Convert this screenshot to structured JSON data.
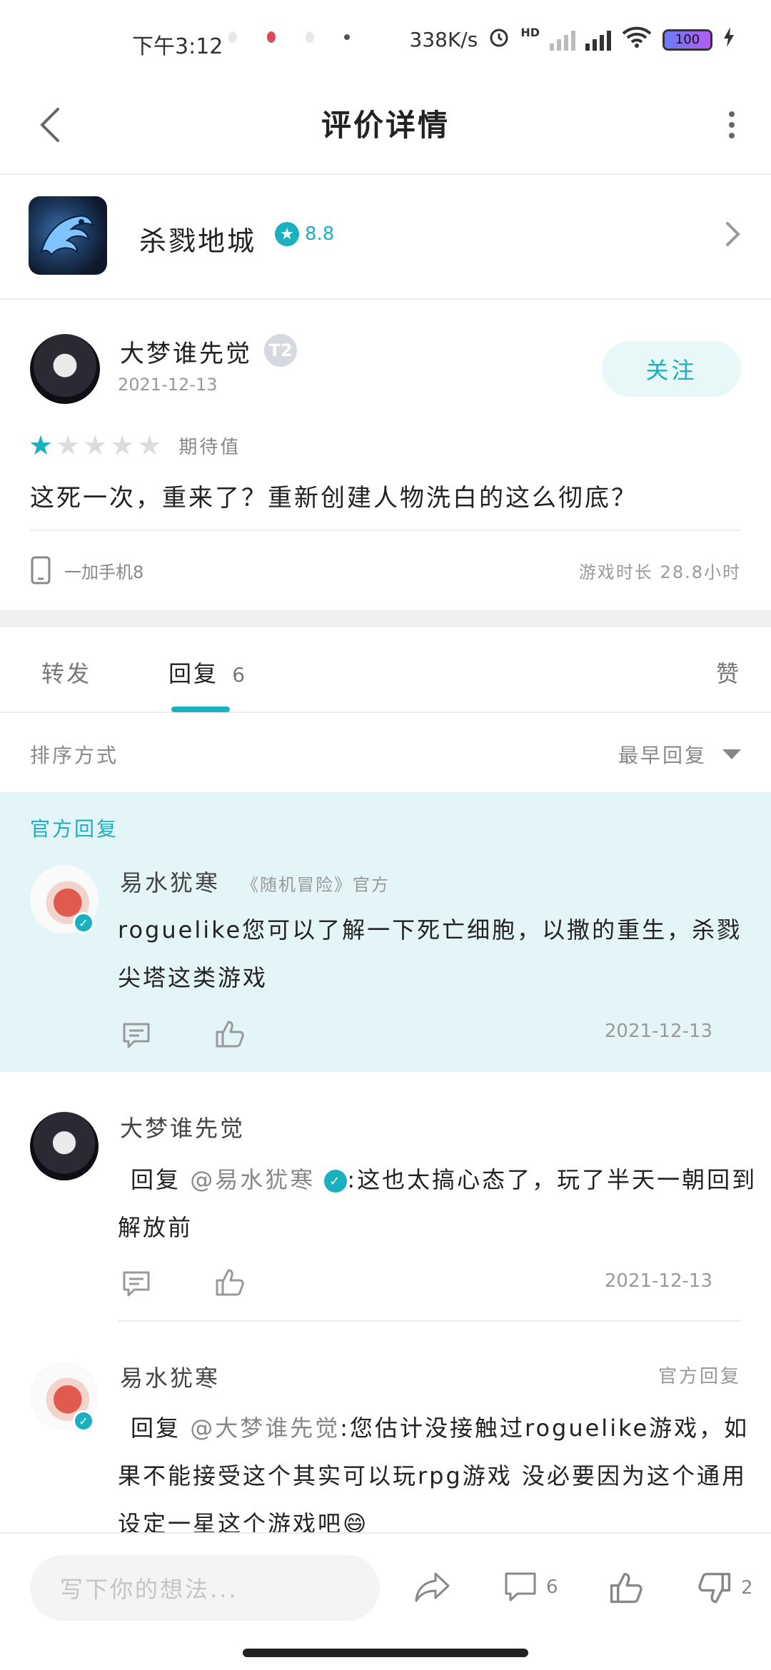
{
  "status_bar": {
    "time": "下午3:12",
    "net_speed": "338K/s",
    "network_label": "HD",
    "battery": "100"
  },
  "header": {
    "title": "评价详情"
  },
  "game": {
    "name": "杀戮地城",
    "rating": "8.8"
  },
  "review": {
    "author": "大梦谁先觉",
    "level_badge": "T2",
    "date": "2021-12-13",
    "follow_label": "关注",
    "stars_filled": 1,
    "stars_total": 5,
    "rating_label": "期待值",
    "text": "这死一次，重来了？重新创建人物洗白的这么彻底？",
    "device": "一加手机8",
    "play_time": "游戏时长 28.8小时"
  },
  "tabs": {
    "forward": "转发",
    "reply": "回复",
    "reply_count": "6",
    "like": "赞"
  },
  "sort": {
    "label": "排序方式",
    "value": "最早回复"
  },
  "official": {
    "section_label": "官方回复",
    "author": "易水犹寒",
    "tag": "《随机冒险》官方",
    "text": "roguelike您可以了解一下死亡细胞，以撒的重生，杀戮尖塔这类游戏",
    "date": "2021-12-13"
  },
  "comments": [
    {
      "author": "大梦谁先觉",
      "reply_word": "回复",
      "mention": "@易水犹寒",
      "text": ":这也太搞心态了，玩了半天一朝回到解放前",
      "date": "2021-12-13"
    },
    {
      "author": "易水犹寒",
      "side_tag": "官方回复",
      "reply_word": "回复",
      "mention": "@大梦谁先觉",
      "text": ":您估计没接触过roguelike游戏，如果不能接受这个其实可以玩rpg游戏 没必要因为这个通用设定一星这个游戏吧😄"
    }
  ],
  "bottom_bar": {
    "input_placeholder": "写下你的想法...",
    "comment_count": "6",
    "dislike_count": "2"
  },
  "colors": {
    "accent": "#1ab0c0",
    "official_bg": "#e4f5f7"
  }
}
